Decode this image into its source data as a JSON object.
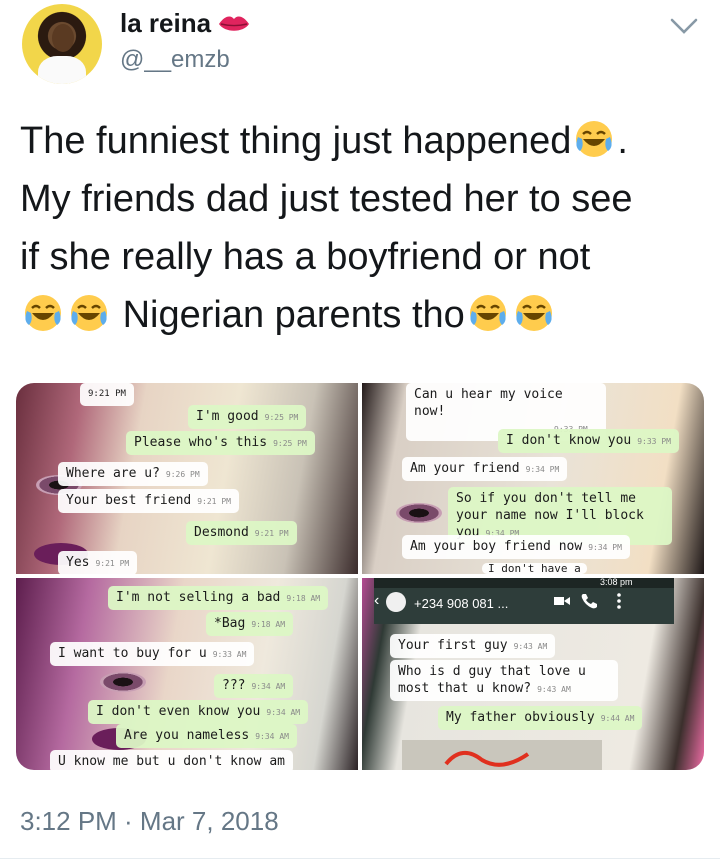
{
  "user": {
    "display_name": "la reina",
    "handle": "@__emzb"
  },
  "icons": {
    "name_badge": "kiss-lips-icon",
    "menu": "chevron-down-icon",
    "emoji": "face-with-tears-of-joy-icon"
  },
  "tweet": {
    "line1": "The funniest thing just happened",
    "line1_end": ".",
    "line2": "My friends dad just tested her to see",
    "line3": "if she really has a boyfriend or not",
    "line4": "Nigerian parents tho"
  },
  "media": {
    "top_left": {
      "bubbles": [
        {
          "text": "9:21 PM",
          "meta": ""
        },
        {
          "text": "I'm good",
          "meta": "9:25 PM"
        },
        {
          "text": "Please who's this",
          "meta": "9:25 PM"
        },
        {
          "text": "Where are u?",
          "meta": "9:26 PM"
        },
        {
          "text": "Your best friend",
          "meta": "9:21 PM"
        },
        {
          "text": "Desmond",
          "meta": "9:21 PM"
        },
        {
          "text": "Yes",
          "meta": "9:21 PM"
        }
      ]
    },
    "top_right": {
      "bubbles": [
        {
          "text": "Can u hear my voice now!",
          "meta": "9:33 PM"
        },
        {
          "text": "I don't know you",
          "meta": "9:33 PM"
        },
        {
          "text": "Am your friend",
          "meta": "9:34 PM"
        },
        {
          "text": "So if you don't tell me your name now I'll block you",
          "meta": "9:34 PM"
        },
        {
          "text": "Am your boy friend now",
          "meta": "9:34 PM"
        },
        {
          "text": "I don't have a",
          "meta": ""
        }
      ]
    },
    "bottom_left": {
      "bubbles": [
        {
          "text": "I'm not selling a bad",
          "meta": "9:18 AM"
        },
        {
          "text": "*Bag",
          "meta": "9:18 AM"
        },
        {
          "text": "I want to buy for u",
          "meta": "9:33 AM"
        },
        {
          "text": "???",
          "meta": "9:34 AM"
        },
        {
          "text": "I don't even know you",
          "meta": "9:34 AM"
        },
        {
          "text": "Are you nameless",
          "meta": "9:34 AM"
        },
        {
          "text": "U know me but u don't know am",
          "meta": ""
        }
      ]
    },
    "bottom_right": {
      "status_time": "3:08 pm",
      "contact": "+234 908 081 ...",
      "bubbles": [
        {
          "text": "Your first guy",
          "meta": "9:43 AM"
        },
        {
          "text": "Who is d guy that love u most that u know?",
          "meta": "9:43 AM"
        },
        {
          "text": "My father obviously",
          "meta": "9:44 AM"
        }
      ]
    }
  },
  "timestamp": "3:12 PM · Mar 7, 2018"
}
